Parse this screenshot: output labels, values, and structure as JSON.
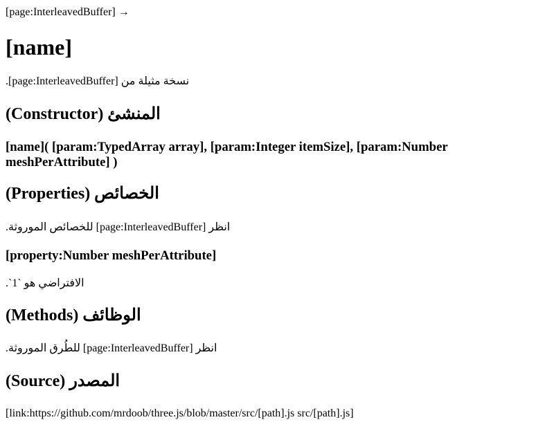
{
  "inherit_link": "[page:InterleavedBuffer] →",
  "title": "[name]",
  "description": "نسخة مثيلة من [page:InterleavedBuffer].",
  "constructor_heading": "المنشئ (Constructor)",
  "constructor_signature": "[name]( [param:TypedArray array], [param:Integer itemSize], [param:Number meshPerAttribute] )",
  "properties_heading": "الخصائص (Properties)",
  "properties_text": "انظر [page:InterleavedBuffer] للخصائص الموروثة.",
  "property_name": "[property:Number meshPerAttribute]",
  "property_default": "الافتراضي هو `1`.",
  "methods_heading": "الوظائف (Methods)",
  "methods_text": "انظر [page:InterleavedBuffer] للطُرق الموروثة.",
  "source_heading": "المصدر (Source)",
  "source_link": "[link:https://github.com/mrdoob/three.js/blob/master/src/[path].js src/[path].js]"
}
